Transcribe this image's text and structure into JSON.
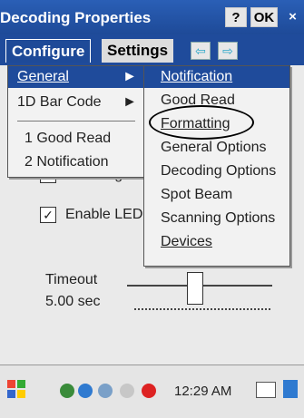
{
  "window": {
    "title": "Decoding Properties",
    "help_button": "?",
    "ok_button": "OK",
    "close_button": "×"
  },
  "tabs": {
    "active": "Configure",
    "inactive": "Settings"
  },
  "menu_left": {
    "items": [
      {
        "label": "General",
        "arrow": "►"
      },
      {
        "label": "1D Bar Code",
        "arrow": "►"
      },
      {
        "label": "1 Good Read"
      },
      {
        "label": "2 Notification"
      }
    ]
  },
  "menu_right": {
    "items": [
      {
        "label": "Notification"
      },
      {
        "label": "Good Read"
      },
      {
        "label": "Formatting"
      },
      {
        "label": "General Options"
      },
      {
        "label": "Decoding Options"
      },
      {
        "label": "Spot Beam"
      },
      {
        "label": "Scanning Options"
      },
      {
        "label": "Devices"
      }
    ]
  },
  "content": {
    "check1_label": "Enable gre",
    "check2_label": "Enable LED",
    "timeout_label": "Timeout",
    "timeout_value": "5.00 sec"
  },
  "taskbar": {
    "time": "12:29 AM"
  }
}
